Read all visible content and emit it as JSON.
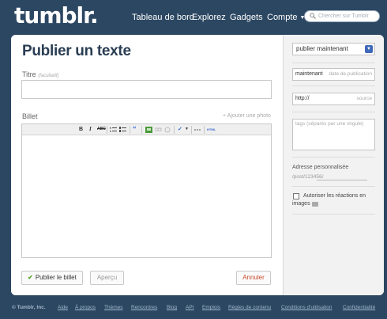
{
  "header": {
    "logo": "tumblr.",
    "nav": {
      "dashboard": "Tableau de bord",
      "explore": "Explorez",
      "gadgets": "Gadgets",
      "account": "Compte"
    },
    "search_placeholder": "Chercher sur Tumblr"
  },
  "form": {
    "heading": "Publier un texte",
    "title_label": "Titre",
    "title_optional": "(facultatif)",
    "body_label": "Billet",
    "add_photo": "+ Ajouter une photo",
    "publish_button": "Publier le billet",
    "preview_button": "Aperçu",
    "cancel_button": "Annuler",
    "toolbar": {
      "bold": "B",
      "italic": "I",
      "strike": "ABC",
      "html": "HTML"
    }
  },
  "sidebar": {
    "publish_select": "publier maintenant",
    "date_value": "maintenant",
    "date_placeholder": "date de publication",
    "source_value": "http://",
    "source_placeholder": "source",
    "tags_placeholder": "tags (séparés par une virgule)",
    "custom_url_label": "Adresse personnalisée",
    "custom_url_prefix": "/post/123456/",
    "reactions_label": "Autoriser les réactions en",
    "reactions_label_2": "images"
  },
  "footer": {
    "copyright": "© Tumblr, Inc.",
    "links": [
      "Aide",
      "À propos",
      "Thèmes",
      "Rencontres",
      "Blog",
      "API",
      "Emplois",
      "Règles de contenu",
      "Conditions d'utilisation",
      "Confidentialité"
    ]
  },
  "colors": {
    "background": "#2c4762",
    "heading": "#2a3e54",
    "cancel": "#c94a2c",
    "check": "#5aa32f"
  }
}
